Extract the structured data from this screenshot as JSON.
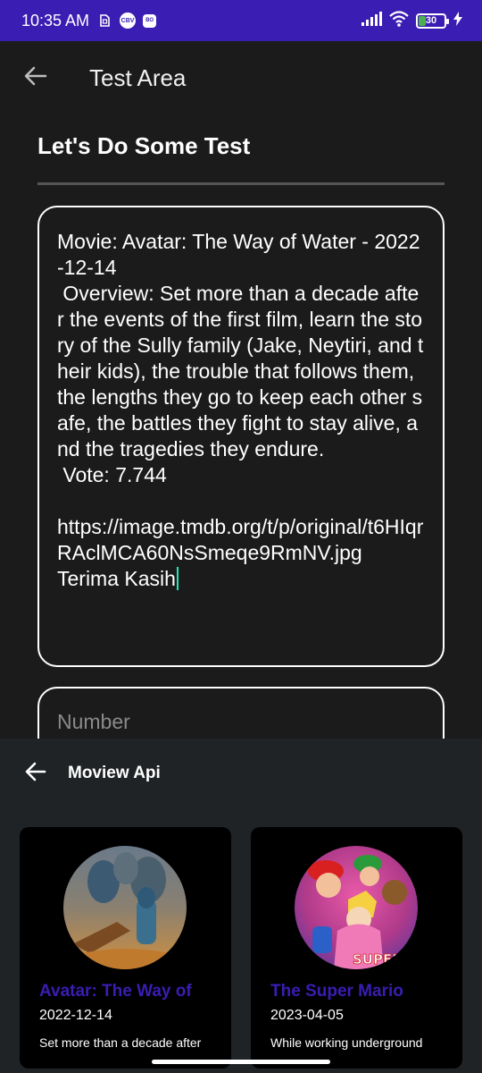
{
  "status_bar": {
    "time": "10:35 AM",
    "icon_badges": [
      "CBV",
      "BO"
    ],
    "battery_level": "30",
    "battery_percent": 30
  },
  "app_bar": {
    "title": "Test Area"
  },
  "main": {
    "heading": "Let's Do Some Test",
    "textarea_value": "Movie: Avatar: The Way of Water - 2022-12-14\n Overview: Set more than a decade after the events of the first film, learn the story of the Sully family (Jake, Neytiri, and their kids), the trouble that follows them, the lengths they go to keep each other safe, the battles they fight to stay alive, and the tragedies they endure.\n Vote: 7.744\n\nhttps://image.tmdb.org/t/p/original/t6HIqrRAclMCA60NsSmeqe9RmNV.jpg\nTerima Kasih",
    "number_placeholder": "Number"
  },
  "sheet": {
    "title": "Moview Api",
    "movies": [
      {
        "title": "Avatar: The Way of",
        "date": "2022-12-14",
        "overview": "Set more than a decade after"
      },
      {
        "title": "The Super Mario",
        "date": "2023-04-05",
        "overview": "While working underground",
        "poster_text": "SUPER"
      }
    ]
  },
  "colors": {
    "status_bar_bg": "#3a1db3",
    "background": "#1b1b1b",
    "sheet_bg": "#1f2326",
    "accent_title": "#3a1db3",
    "cursor": "#1de9b6"
  }
}
